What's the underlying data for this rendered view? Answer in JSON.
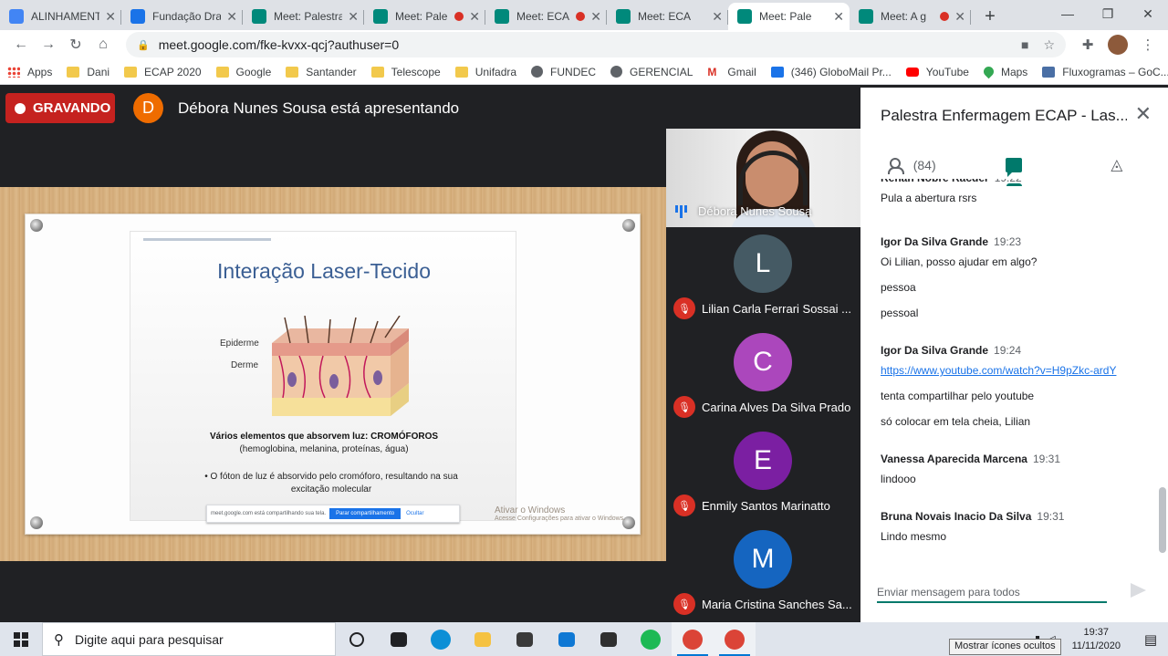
{
  "browser": {
    "tabs": [
      {
        "title": "ALINHAMENTO",
        "favicon_color": "#4285f4",
        "recording": false,
        "active": false
      },
      {
        "title": "Fundação Dra",
        "favicon_color": "#1a73e8",
        "recording": false,
        "active": false
      },
      {
        "title": "Meet: Palestra",
        "favicon_color": "#00897b",
        "recording": false,
        "active": false
      },
      {
        "title": "Meet: Pale",
        "favicon_color": "#00897b",
        "recording": true,
        "active": false
      },
      {
        "title": "Meet: ECA",
        "favicon_color": "#00897b",
        "recording": true,
        "active": false
      },
      {
        "title": "Meet: ECA",
        "favicon_color": "#00897b",
        "recording": false,
        "active": false
      },
      {
        "title": "Meet: Pale",
        "favicon_color": "#00897b",
        "recording": false,
        "active": true
      },
      {
        "title": "Meet: A g",
        "favicon_color": "#00897b",
        "recording": true,
        "active": false
      }
    ],
    "new_tab_label": "+",
    "url": "meet.google.com/fke-kvxx-qcj?authuser=0",
    "bookmarks": [
      {
        "label": "Apps",
        "icon": "apps-grid-icon"
      },
      {
        "label": "Dani",
        "icon": "folder-icon"
      },
      {
        "label": "ECAP 2020",
        "icon": "folder-icon"
      },
      {
        "label": "Google",
        "icon": "folder-icon"
      },
      {
        "label": "Santander",
        "icon": "folder-icon"
      },
      {
        "label": "Telescope",
        "icon": "folder-icon"
      },
      {
        "label": "Unifadra",
        "icon": "folder-icon"
      },
      {
        "label": "FUNDEC",
        "icon": "globe-icon"
      },
      {
        "label": "GERENCIAL",
        "icon": "globe-icon"
      },
      {
        "label": "Gmail",
        "icon": "gmail-icon"
      },
      {
        "label": "(346) GloboMail Pr...",
        "icon": "globomail-icon"
      },
      {
        "label": "YouTube",
        "icon": "youtube-icon"
      },
      {
        "label": "Maps",
        "icon": "maps-icon"
      },
      {
        "label": "Fluxogramas – GoC...",
        "icon": "fluxogramas-icon"
      }
    ],
    "bookmarks_more": "»"
  },
  "meet": {
    "recording_label": "GRAVANDO",
    "presenter_initial": "D",
    "presenter_text": "Débora Nunes Sousa está apresentando",
    "slide": {
      "title": "Interação Laser-Tecido",
      "label_epidermis": "Epiderme",
      "label_dermis": "Derme",
      "bold_line": "Vários elementos que absorvem luz: CROMÓFOROS",
      "sub_line": "(hemoglobina, melanina, proteínas, água)",
      "bullet_line1": "•   O fóton de luz é absorvido pelo cromóforo, resultando na sua",
      "bullet_line2": "excitação molecular"
    },
    "share_bar": {
      "text": "meet.google.com está compartilhando sua tela.",
      "stop_label": "Parar compartilhamento",
      "hide_label": "Ocultar"
    },
    "windows_watermark": {
      "line1": "Ativar o Windows",
      "line2": "Acesse Configurações para ativar o Windows."
    },
    "video_participant": "Débora Nunes Sousa",
    "participants": [
      {
        "initial": "L",
        "name": "Lilian Carla Ferrari Sossai ...",
        "color": "#455a64"
      },
      {
        "initial": "C",
        "name": "Carina Alves Da Silva Prado",
        "color": "#ab47bc"
      },
      {
        "initial": "E",
        "name": "Enmily Santos Marinatto",
        "color": "#7b1fa2"
      },
      {
        "initial": "M",
        "name": "Maria Cristina Sanches Sa...",
        "color": "#1565c0"
      }
    ]
  },
  "panel": {
    "title": "Palestra Enfermagem ECAP - Las...",
    "people_count": "(84)",
    "messages": [
      {
        "sender": "Renan Nobre Racder",
        "time": "19:22",
        "lines": [
          "Pula a abertura rsrs"
        ],
        "partial": true
      },
      {
        "sender": "Igor Da Silva Grande",
        "time": "19:23",
        "lines": [
          "Oi Lilian, posso ajudar em algo?",
          "pessoa",
          "pessoal"
        ]
      },
      {
        "sender": "Igor Da Silva Grande",
        "time": "19:24",
        "lines": [
          "https://www.youtube.com/watch?v=H9pZkc-ardY",
          "tenta compartilhar pelo youtube",
          "só colocar em tela cheia, Lilian"
        ]
      },
      {
        "sender": "Vanessa Aparecida Marcena",
        "time": "19:31",
        "lines": [
          "lindooo"
        ]
      },
      {
        "sender": "Bruna Novais Inacio Da Silva",
        "time": "19:31",
        "lines": [
          "Lindo mesmo"
        ]
      }
    ],
    "composer_placeholder": "Enviar mensagem para todos"
  },
  "taskbar": {
    "search_placeholder": "Digite aqui para pesquisar",
    "time": "19:37",
    "date": "11/11/2020",
    "tooltip": "Mostrar ícones ocultos",
    "apps": [
      {
        "name": "cortana-icon",
        "color": "#202124",
        "shape": "ring"
      },
      {
        "name": "task-view-icon",
        "color": "#202124",
        "shape": "square"
      },
      {
        "name": "edge-icon",
        "color": "#0c8fd6",
        "shape": "round"
      },
      {
        "name": "file-explorer-icon",
        "color": "#f5c242",
        "shape": "square"
      },
      {
        "name": "store-icon",
        "color": "#3a3a3a",
        "shape": "square"
      },
      {
        "name": "mail-icon",
        "color": "#0f78d4",
        "shape": "square"
      },
      {
        "name": "sticky-notes-icon",
        "color": "#2f2f2f",
        "shape": "square"
      },
      {
        "name": "spotify-icon",
        "color": "#1db954",
        "shape": "round"
      },
      {
        "name": "chrome-icon",
        "color": "#db4437",
        "shape": "round",
        "active": true
      },
      {
        "name": "chrome-icon",
        "color": "#db4437",
        "shape": "round",
        "active": true
      }
    ]
  }
}
